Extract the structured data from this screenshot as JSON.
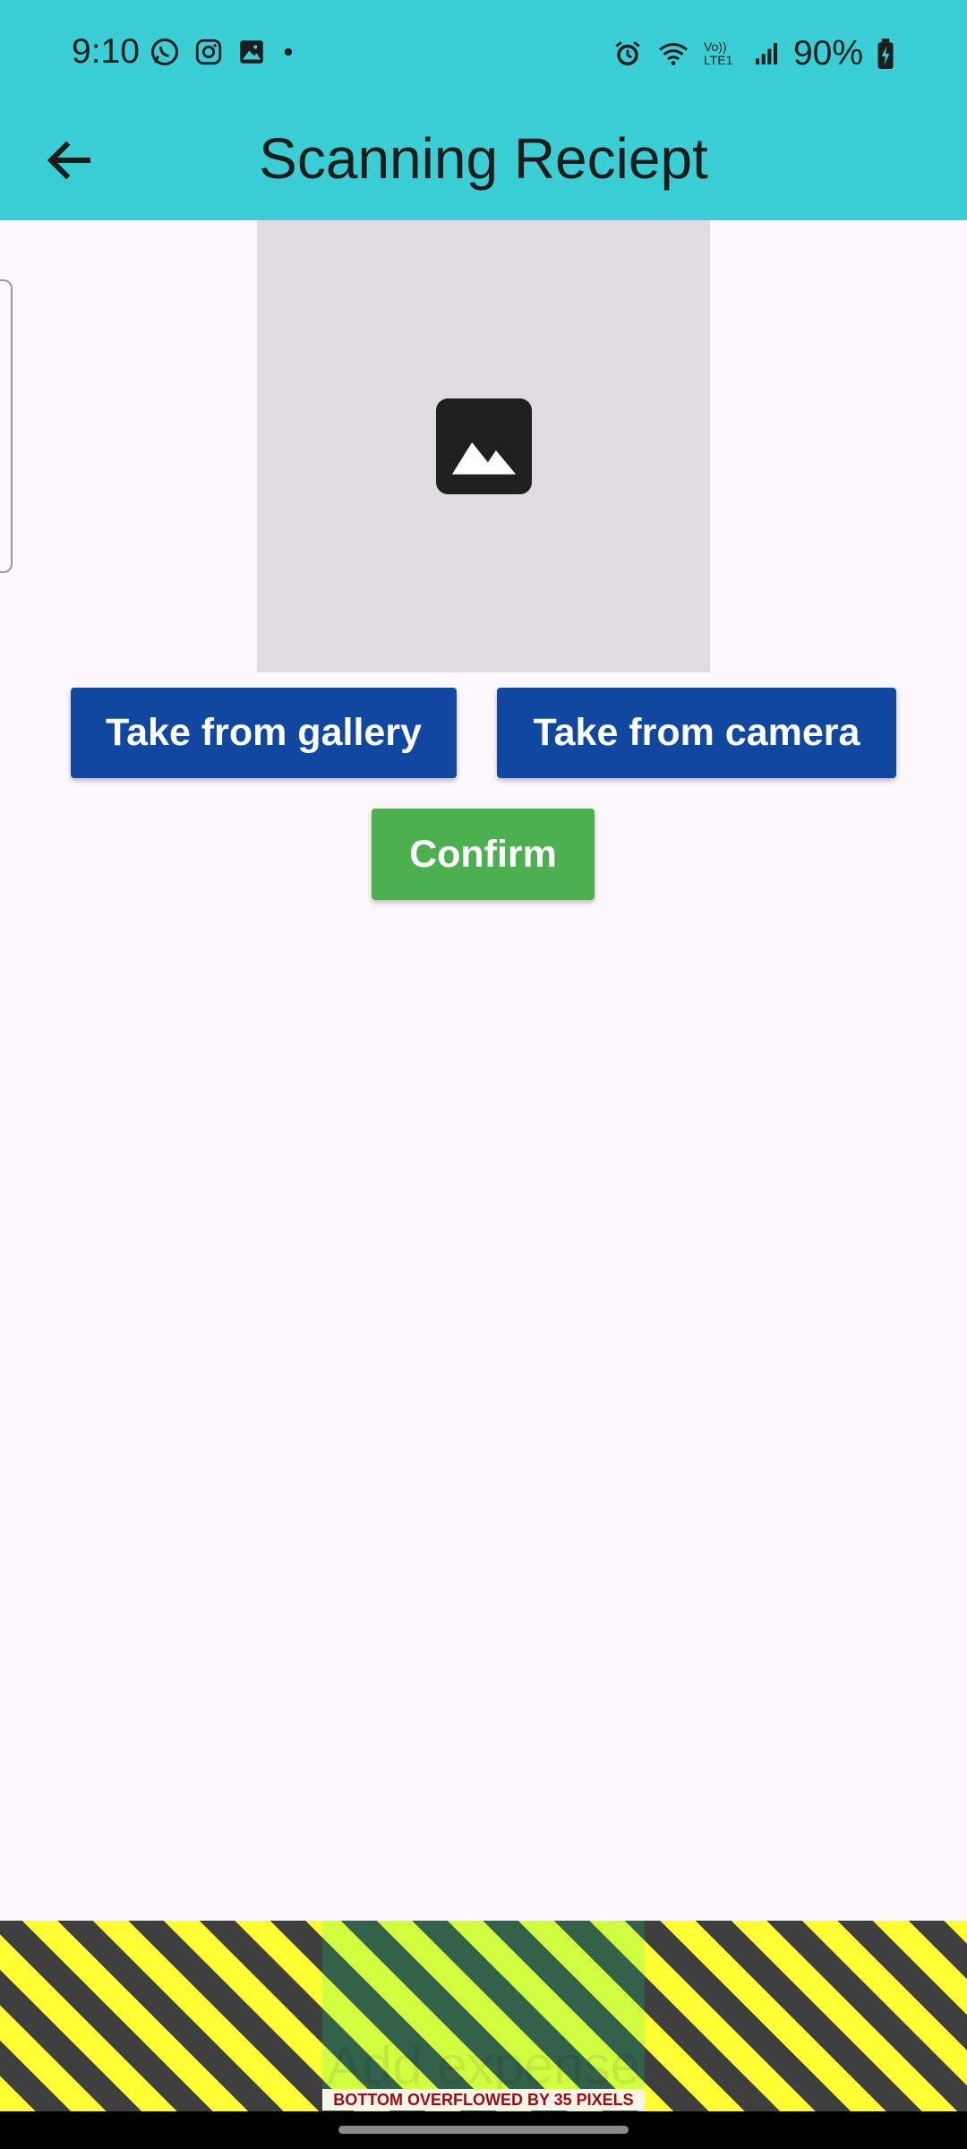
{
  "status_bar": {
    "time": "9:10",
    "battery": "90%",
    "left_icons": [
      "whatsapp-icon",
      "instagram-icon",
      "gallery-icon",
      "dot-icon"
    ],
    "right_icons": [
      "alarm-icon",
      "wifi-icon",
      "volte-icon",
      "signal-icon",
      "battery-charging-icon"
    ],
    "volte_label": "Vo)) LTE1"
  },
  "app_bar": {
    "title": "Scanning Reciept",
    "back_icon": "arrow-back-icon",
    "background": "#3acfd5"
  },
  "image_preview": {
    "icon": "image-placeholder-icon"
  },
  "buttons": {
    "gallery": "Take from gallery",
    "camera": "Take from camera",
    "confirm": "Confirm"
  },
  "colors": {
    "primary_button": "#0f47a1",
    "confirm_button": "#4caf50"
  },
  "overflow": {
    "ghost_label": "Add expense",
    "message": "BOTTOM OVERFLOWED BY 35 PIXELS"
  }
}
